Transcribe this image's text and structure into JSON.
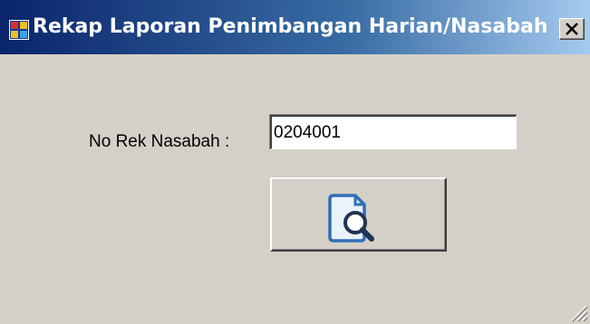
{
  "window": {
    "title": "Rekap Laporan Penimbangan Harian/Nasabah",
    "icon": "app-window-icon",
    "close_icon": "close-icon"
  },
  "form": {
    "account_label": "No Rek Nasabah :",
    "account_value": "0204001",
    "preview_button_icon": "document-search-icon"
  },
  "colors": {
    "titlebar_start": "#0a246a",
    "titlebar_end": "#a6caf0",
    "face": "#d4d0c8",
    "icon_blue": "#2f6fb6"
  }
}
